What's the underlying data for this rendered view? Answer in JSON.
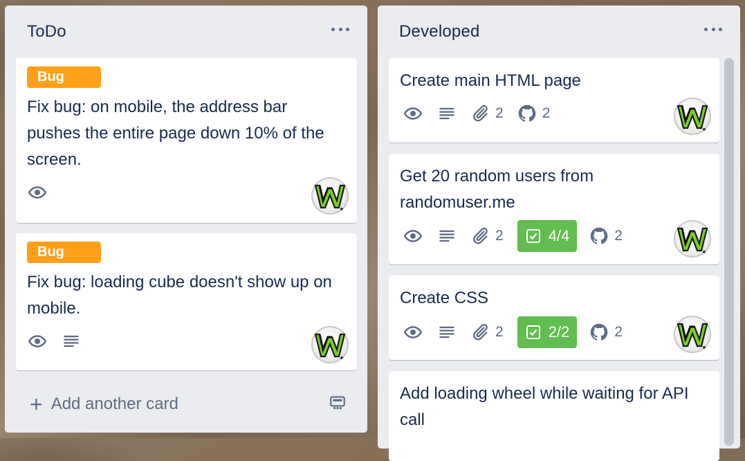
{
  "lists": [
    {
      "title": "ToDo",
      "cards": [
        {
          "label": "Bug",
          "title": "Fix bug: on mobile, the address bar pushes the entire page down 10% of the screen."
        },
        {
          "label": "Bug",
          "title": "Fix bug: loading cube doesn't show up on mobile."
        }
      ],
      "add_card_label": "Add another card"
    },
    {
      "title": "Developed",
      "cards": [
        {
          "title": "Create main HTML page",
          "attachments": "2",
          "github": "2"
        },
        {
          "title": "Get 20 random users from randomuser.me",
          "attachments": "2",
          "checklist": "4/4",
          "github": "2"
        },
        {
          "title": "Create CSS",
          "attachments": "2",
          "checklist": "2/2",
          "github": "2"
        },
        {
          "title": "Add loading wheel while waiting for API call"
        }
      ]
    }
  ],
  "colors": {
    "label_orange": "#ff9f1a",
    "checklist_green": "#61bd4f",
    "list_bg": "#ebecf0",
    "text": "#172b4d",
    "muted": "#5e6c84"
  },
  "icons": [
    "eye-icon",
    "description-icon",
    "paperclip-icon",
    "github-icon",
    "checkbox-icon",
    "plus-icon",
    "card-template-icon",
    "more-icon"
  ]
}
